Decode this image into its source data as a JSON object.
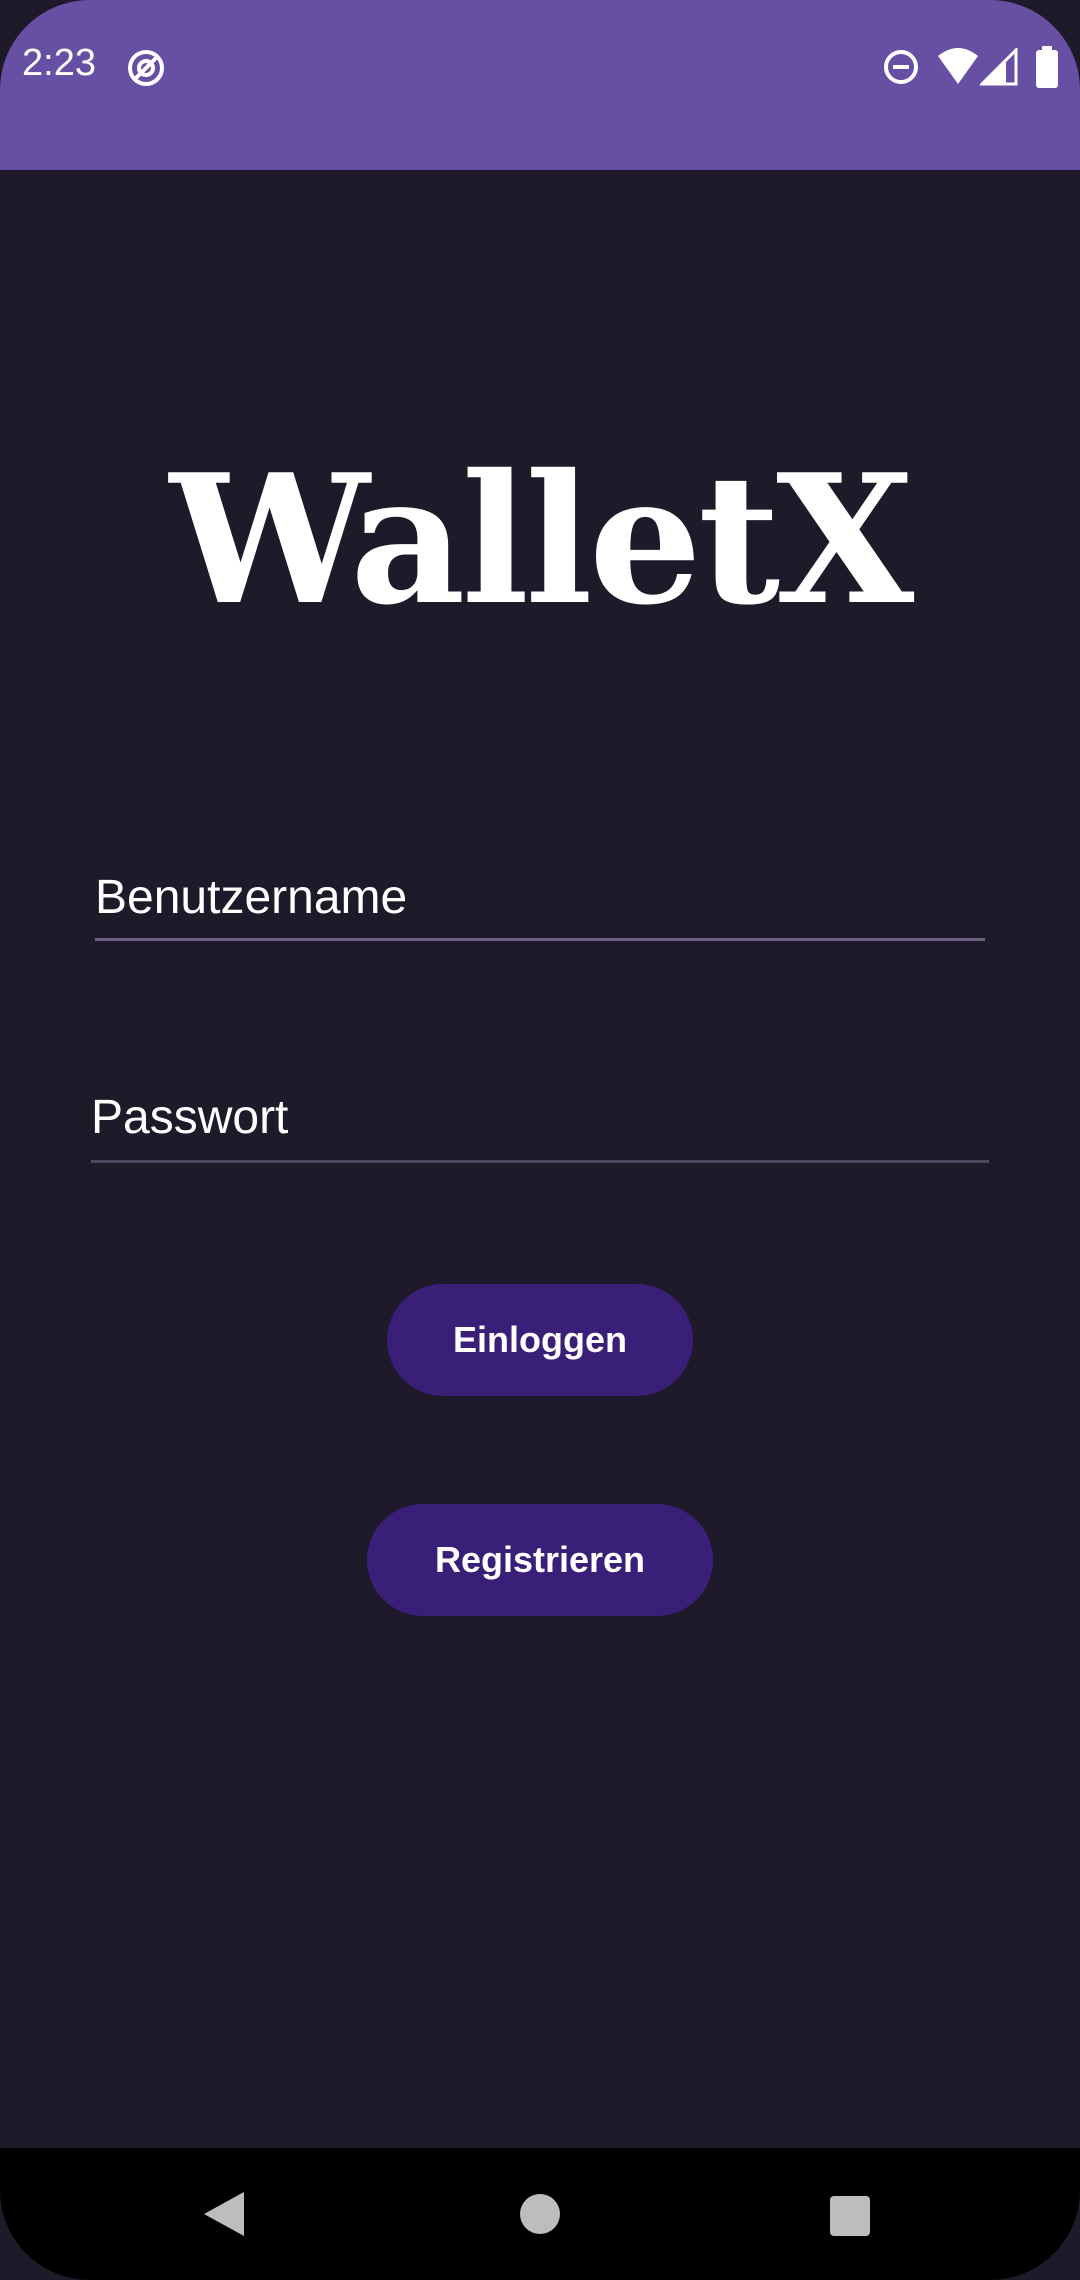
{
  "status_bar": {
    "time": "2:23",
    "icons": [
      "at-sign-icon",
      "do-not-disturb-icon",
      "wifi-icon",
      "signal-icon",
      "battery-icon"
    ]
  },
  "app": {
    "logo_text": "WalletX"
  },
  "login_form": {
    "username_placeholder": "Benutzername",
    "password_placeholder": "Passwort",
    "login_label": "Einloggen",
    "register_label": "Registrieren"
  },
  "nav_bar": {
    "icons": [
      "back-icon",
      "home-icon",
      "recents-icon"
    ]
  },
  "colors": {
    "status_bar": "#6750a4",
    "background": "#1e1a2a",
    "button": "#3a1f78",
    "text": "#ffffff"
  }
}
